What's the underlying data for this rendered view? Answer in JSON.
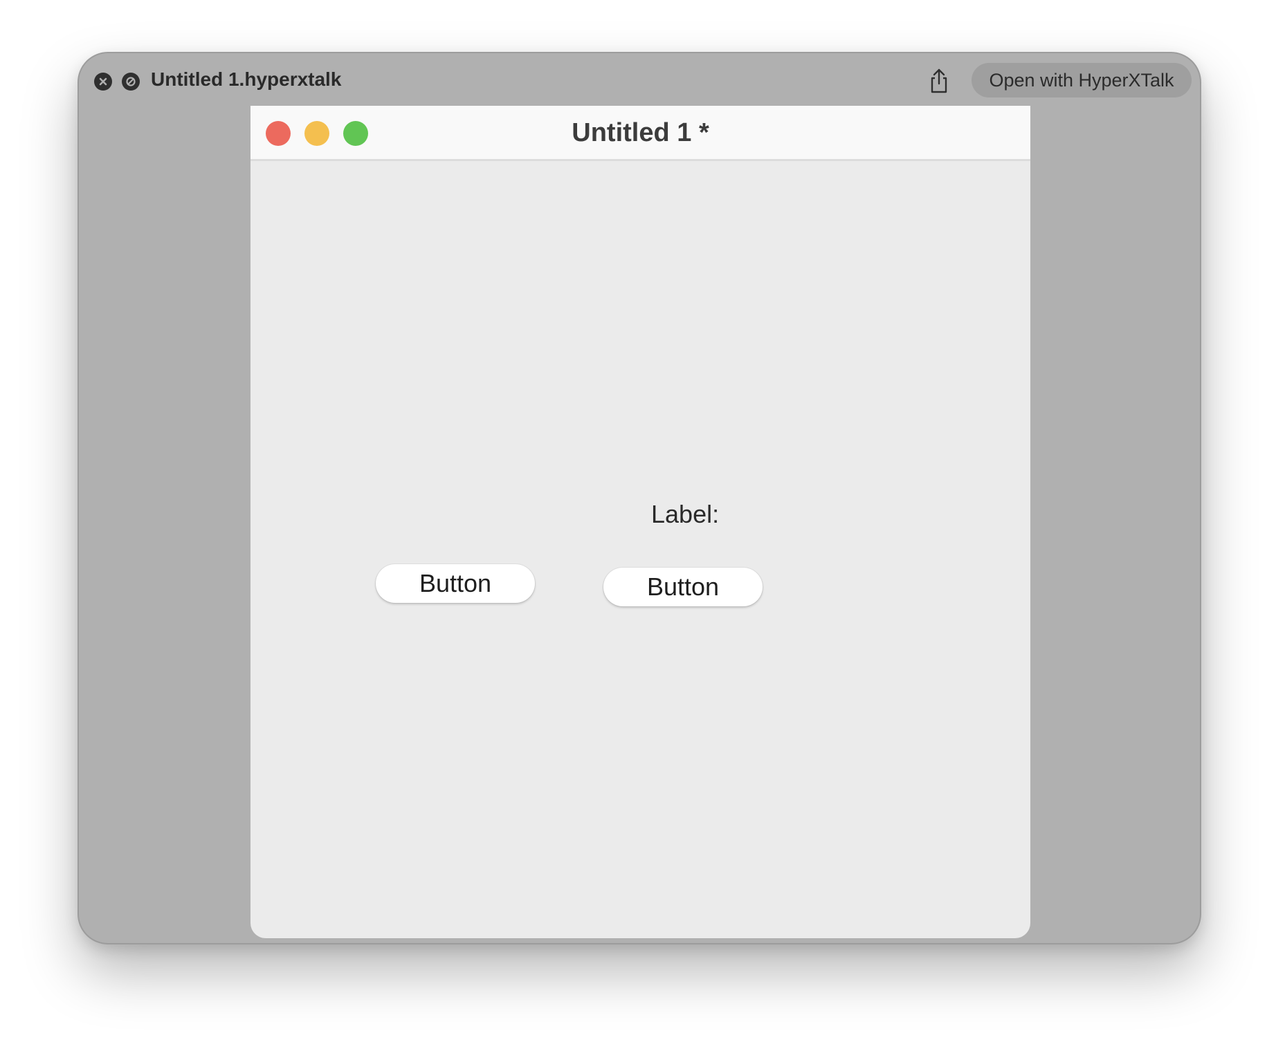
{
  "quicklook": {
    "file_title": "Untitled 1.hyperxtalk",
    "open_with_label": "Open with HyperXTalk",
    "icons": {
      "close": "close-circle-icon",
      "block": "block-circle-icon",
      "share": "share-icon"
    }
  },
  "app_window": {
    "title": "Untitled 1 *",
    "traffic_lights": {
      "close_color": "#ec6a5e",
      "minimize_color": "#f4bf4f",
      "maximize_color": "#61c554"
    },
    "canvas": {
      "label": "Label:",
      "buttons": [
        {
          "label": "Button"
        },
        {
          "label": "Button"
        }
      ]
    }
  }
}
